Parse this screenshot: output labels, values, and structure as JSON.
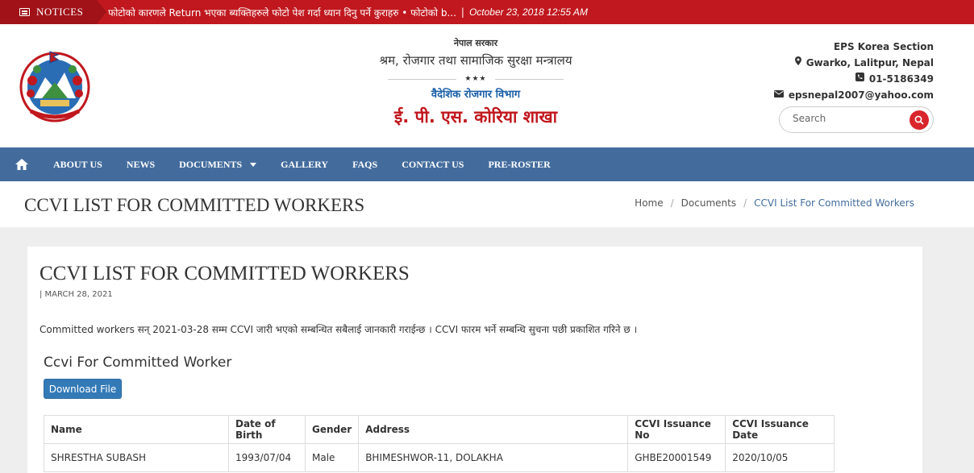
{
  "notice": {
    "label": "NOTICES",
    "text": "फोटोको कारणले Return भएका ब्यक्तिहरुले फोटो पेश गर्दा ध्यान दिनु पर्ने कुराहरु • फोटोको b...",
    "separator": "|",
    "date": "October 23, 2018 12:55 AM"
  },
  "header": {
    "gov_line1": "नेपाल सरकार",
    "gov_line2": "श्रम, रोजगार तथा सामाजिक सुरक्षा मन्त्रालय",
    "stars": "★★★",
    "gov_line3": "वैदेशिक रोजगार विभाग",
    "gov_line4": "ई. पी. एस. कोरिया शाखा",
    "contact": {
      "section": "EPS Korea Section",
      "address": "Gwarko, Lalitpur, Nepal",
      "phone": "01-5186349",
      "email": "epsnepal2007@yahoo.com"
    },
    "search": {
      "placeholder": "Search"
    }
  },
  "nav": {
    "items": [
      "ABOUT US",
      "NEWS",
      "DOCUMENTS",
      "GALLERY",
      "FAQS",
      "CONTACT US",
      "PRE-ROSTER"
    ]
  },
  "page": {
    "title": "CCVI LIST FOR COMMITTED WORKERS",
    "breadcrumb": [
      "Home",
      "Documents",
      "CCVI List For Committed Workers"
    ],
    "breadcrumb_sep": "/"
  },
  "article": {
    "title": "CCVI LIST FOR COMMITTED WORKERS",
    "date": "| MARCH 28, 2021",
    "body": "Committed workers सन् 2021-03-28 सम्म CCVI जारी भएको सम्बन्धित सबैलाई जानकारी गराईन्छ । CCVI फारम भर्ने सम्बन्धि सुचना पछी प्रकाशित गरिने छ ।",
    "file_title": "Ccvi For Committed Worker",
    "download_label": "Download File"
  },
  "table": {
    "headers": [
      "Name",
      "Date of Birth",
      "Gender",
      "Address",
      "CCVI Issuance No",
      "CCVI Issuance Date"
    ],
    "rows": [
      [
        "SHRESTHA SUBASH",
        "1993/07/04",
        "Male",
        "BHIMESHWOR-11, DOLAKHA",
        "GHBE20001549",
        "2020/10/05"
      ]
    ]
  },
  "colors": {
    "notice_red": "#c0181e",
    "nav_blue": "#436c9d",
    "button_blue": "#337ab7",
    "accent_red": "#d9262c"
  }
}
